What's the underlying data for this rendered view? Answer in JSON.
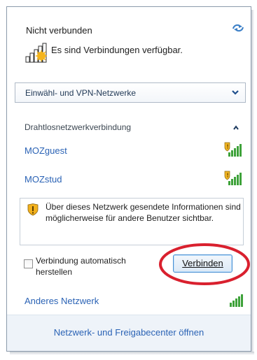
{
  "header": {
    "title": "Nicht verbunden",
    "status": "Es sind Verbindungen verfügbar."
  },
  "dropdown": {
    "label": "Einwähl- und VPN-Netzwerke"
  },
  "wireless": {
    "section_label": "Drahtlosnetzwerkverbindung",
    "networks": [
      {
        "name": "MOZguest",
        "secured": true
      },
      {
        "name": "MOZstud",
        "secured": true
      }
    ]
  },
  "warning": {
    "text": "Über dieses Netzwerk gesendete Informationen sind möglicherweise für andere Benutzer sichtbar."
  },
  "auto_connect": {
    "label": "Verbindung automatisch herstellen",
    "checked": false
  },
  "connect_button": {
    "label": "Verbinden"
  },
  "other_network": {
    "label": "Anderes Netzwerk"
  },
  "footer": {
    "link": "Netzwerk- und Freigabecenter öffnen"
  },
  "colors": {
    "link": "#2b63b5",
    "highlight_ring": "#d9202e",
    "signal": "#3ea23a"
  }
}
